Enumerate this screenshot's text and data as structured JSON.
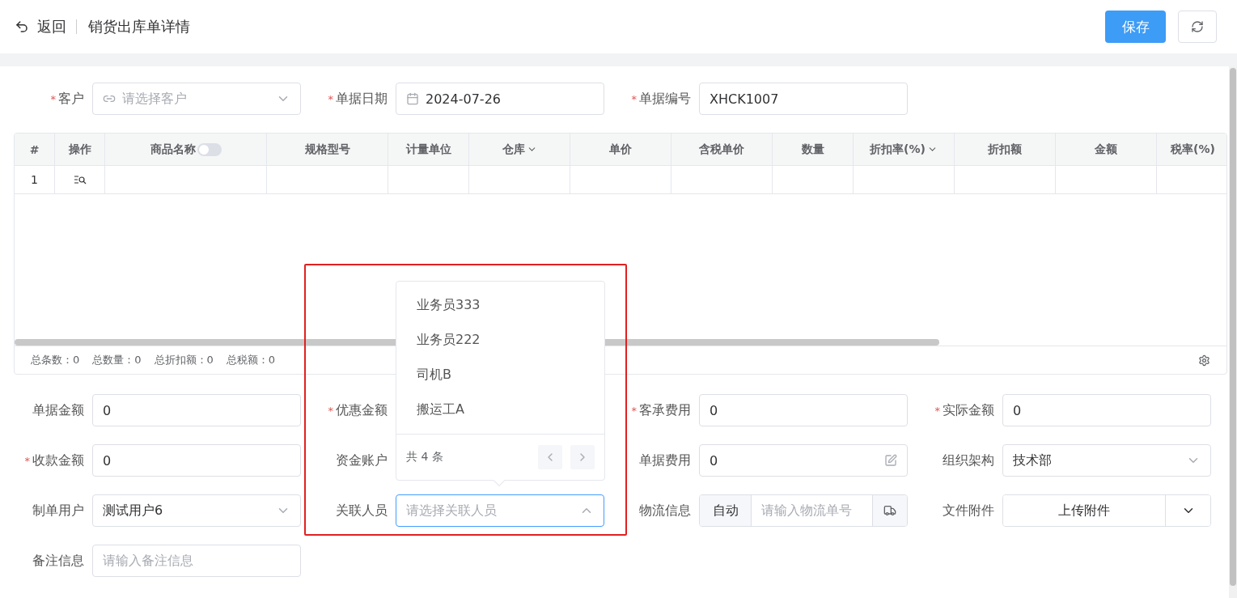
{
  "header": {
    "back": "返回",
    "title": "销货出库单详情",
    "save": "保存"
  },
  "top_fields": [
    {
      "mark": "*",
      "label": "客户",
      "kind": "select",
      "placeholder": "请选择客户",
      "link_icon": true
    },
    {
      "mark": "*",
      "label": "单据日期",
      "kind": "date",
      "value": "2024-07-26"
    },
    {
      "mark": "*",
      "label": "单据编号",
      "kind": "input",
      "value": "XHCK1007"
    }
  ],
  "table": {
    "columns": [
      {
        "label": "#"
      },
      {
        "label": "操作"
      },
      {
        "label": "商品名称",
        "switch": {
          "on": false
        }
      },
      {
        "label": "规格型号"
      },
      {
        "label": "计量单位"
      },
      {
        "label": "仓库",
        "dropdown": true
      },
      {
        "label": "单价"
      },
      {
        "label": "含税单价"
      },
      {
        "label": "数量"
      },
      {
        "label": "折扣率(%)",
        "dropdown": true
      },
      {
        "label": "折扣额"
      },
      {
        "label": "金额"
      },
      {
        "label": "税率(%)"
      }
    ],
    "rows": [
      {
        "index": "1"
      }
    ],
    "summary": [
      "总条数：0",
      "总数量：0",
      "总折扣额：0",
      "总税额：0"
    ]
  },
  "form_fields": [
    {
      "label": "单据金额",
      "kind": "input",
      "value": "0"
    },
    {
      "mark": "*",
      "label": "优惠金额",
      "kind": "covered"
    },
    {
      "mark": "*",
      "label": "客承费用",
      "kind": "input",
      "value": "0"
    },
    {
      "mark": "*",
      "label": "实际金额",
      "kind": "input",
      "value": "0"
    },
    {
      "mark": "*",
      "label": "收款金额",
      "kind": "input",
      "value": "0"
    },
    {
      "label": "资金账户",
      "kind": "covered"
    },
    {
      "label": "单据费用",
      "kind": "edit",
      "value": "0"
    },
    {
      "label": "组织架构",
      "kind": "select",
      "value": "技术部"
    },
    {
      "label": "制单用户",
      "kind": "select",
      "value": "测试用户6"
    },
    {
      "label": "关联人员",
      "kind": "select",
      "placeholder": "请选择关联人员",
      "open": true
    },
    {
      "label": "物流信息",
      "kind": "logistics",
      "addon": "自动",
      "placeholder": "请输入物流单号"
    },
    {
      "label": "文件附件",
      "kind": "upload",
      "value": "上传附件"
    },
    {
      "label": "备注信息",
      "kind": "input",
      "placeholder": "请输入备注信息"
    }
  ],
  "dropdown": {
    "options": [
      "业务员333",
      "业务员222",
      "司机B",
      "搬运工A"
    ],
    "total": "共 4 条"
  }
}
